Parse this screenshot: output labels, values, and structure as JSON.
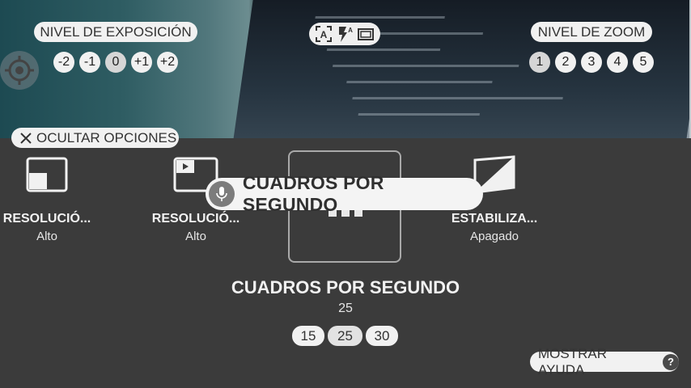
{
  "exposure": {
    "label": "NIVEL DE EXPOSICIÓN",
    "levels": [
      "-2",
      "-1",
      "0",
      "+1",
      "+2"
    ],
    "selected": "0"
  },
  "zoom": {
    "label": "NIVEL DE ZOOM",
    "levels": [
      "1",
      "2",
      "3",
      "4",
      "5"
    ],
    "selected": "1"
  },
  "quick_icons": [
    "auto-focus-icon",
    "flash-auto-icon",
    "aspect-ratio-icon"
  ],
  "focus_target_icon": "crosshair-icon",
  "options_panel": {
    "hide_label": "OCULTAR OPCIONES",
    "items": [
      {
        "title": "RESOLUCIÓ...",
        "value": "Alto",
        "icon": "photo-resolution-icon"
      },
      {
        "title": "RESOLUCIÓ...",
        "value": "Alto",
        "icon": "video-resolution-icon"
      },
      {
        "title": "",
        "value": "",
        "icon": "frame-rate-icon"
      },
      {
        "title": "ESTABILIZA...",
        "value": "Apagado",
        "icon": "stabilization-icon"
      }
    ],
    "tooltip": "CUADROS POR SEGUNDO"
  },
  "selected_option": {
    "title": "CUADROS POR SEGUNDO",
    "value": "25",
    "choices": [
      "15",
      "25",
      "30"
    ]
  },
  "help_label": "MOSTRAR AYUDA",
  "help_icon": "?"
}
